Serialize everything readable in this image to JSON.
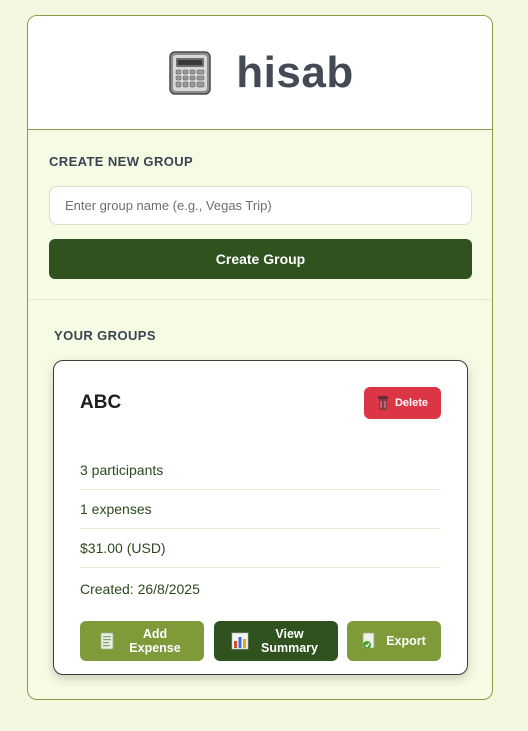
{
  "app": {
    "title": "hisab",
    "logo_icon": "calculator-icon"
  },
  "create": {
    "section_label": "CREATE NEW GROUP",
    "input_placeholder": "Enter group name (e.g., Vegas Trip)",
    "input_value": "",
    "button_label": "Create Group"
  },
  "groups": {
    "section_label": "YOUR GROUPS",
    "items": [
      {
        "name": "ABC",
        "delete_label": "Delete",
        "participants": "3 participants",
        "expenses": "1 expenses",
        "total": "$31.00 (USD)",
        "created": "Created: 26/8/2025",
        "actions": {
          "add_expense": "Add Expense",
          "view_summary": "View Summary",
          "export": "Export"
        }
      }
    ]
  },
  "colors": {
    "page_bg": "#f3f9e0",
    "accent_dark": "#2f521e",
    "accent_light": "#7f9a38",
    "danger": "#dc3545",
    "border": "#8a9a48"
  }
}
